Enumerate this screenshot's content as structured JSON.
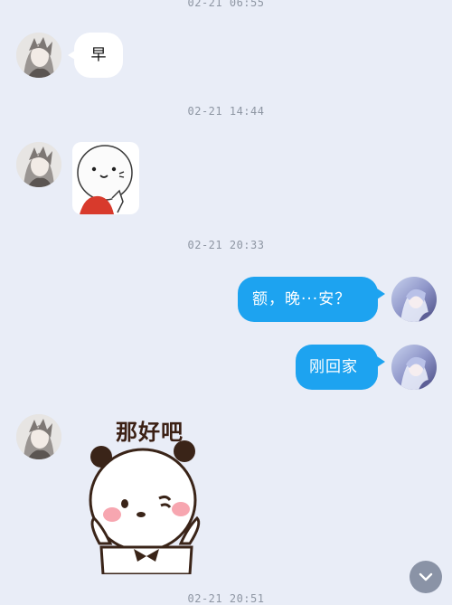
{
  "timestamps": [
    "02-21 06:55",
    "02-21 14:44",
    "02-21 20:33",
    "02-21 20:51"
  ],
  "messages": {
    "m1": "早",
    "m3": "额，晚···安？",
    "m4": "刚回家"
  },
  "sticker_caption": "那好吧",
  "icons": {
    "contact_avatar": "contact-avatar-icon",
    "self_avatar": "self-avatar-icon",
    "scroll_down": "chevron-down-icon"
  },
  "colors": {
    "background": "#e9edf7",
    "outgoing_bubble": "#1da3f0",
    "incoming_bubble": "#ffffff"
  }
}
